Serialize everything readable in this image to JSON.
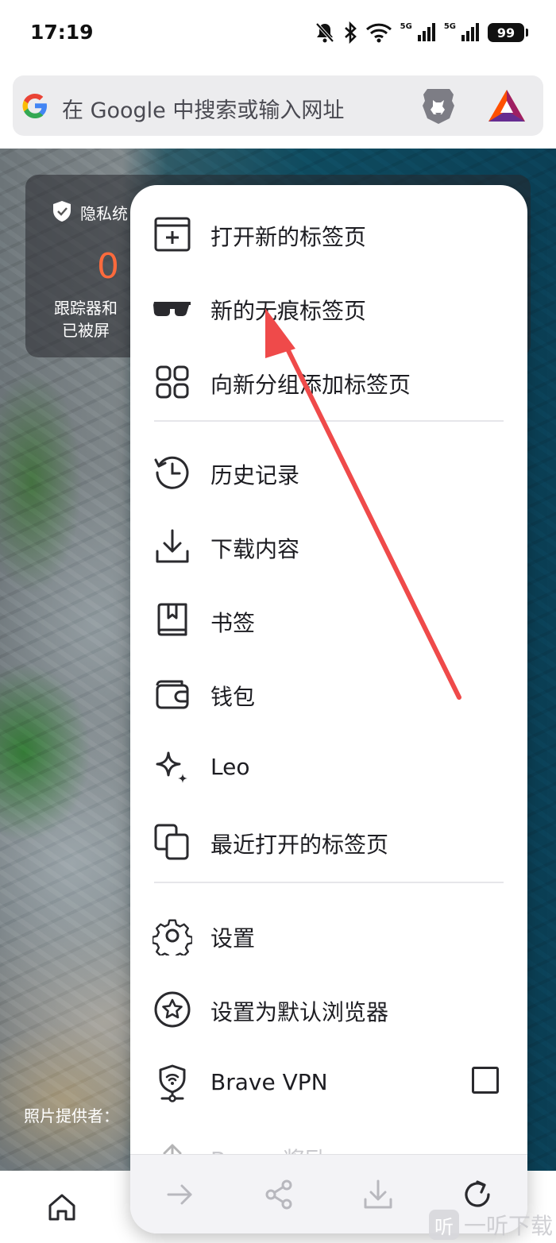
{
  "status_bar": {
    "time": "17:19",
    "signal1_label": "5G",
    "signal2_label": "5G",
    "battery": "99"
  },
  "search": {
    "placeholder": "在 Google 中搜索或输入网址"
  },
  "privacy_card": {
    "title": "隐私统",
    "count": "0",
    "desc_line1": "跟踪器和",
    "desc_line2": "已被屏"
  },
  "photo_credit": "照片提供者：",
  "menu": {
    "items": [
      {
        "label": "打开新的标签页",
        "icon": "new-tab-icon"
      },
      {
        "label": "新的无痕标签页",
        "icon": "incognito-glasses-icon"
      },
      {
        "label": "向新分组添加标签页",
        "icon": "tab-group-icon"
      },
      {
        "label": "历史记录",
        "icon": "history-icon"
      },
      {
        "label": "下载内容",
        "icon": "download-icon"
      },
      {
        "label": "书签",
        "icon": "bookmark-icon"
      },
      {
        "label": "钱包",
        "icon": "wallet-icon"
      },
      {
        "label": "Leo",
        "icon": "leo-sparkle-icon"
      },
      {
        "label": "最近打开的标签页",
        "icon": "recent-tabs-icon"
      },
      {
        "label": "设置",
        "icon": "gear-icon"
      },
      {
        "label": "设置为默认浏览器",
        "icon": "default-browser-icon"
      },
      {
        "label": "Brave VPN",
        "icon": "vpn-icon",
        "checked": false
      },
      {
        "label": "Brave 奖励",
        "icon": "rewards-icon"
      }
    ],
    "footer": [
      "forward-icon",
      "share-icon",
      "download-icon",
      "reload-icon"
    ]
  },
  "watermark": {
    "logo_char": "听",
    "text": "一听下载"
  },
  "colors": {
    "accent_orange": "#ff6b3d",
    "arrow_red": "#ef4a4a",
    "menu_text": "#1d1d22"
  }
}
